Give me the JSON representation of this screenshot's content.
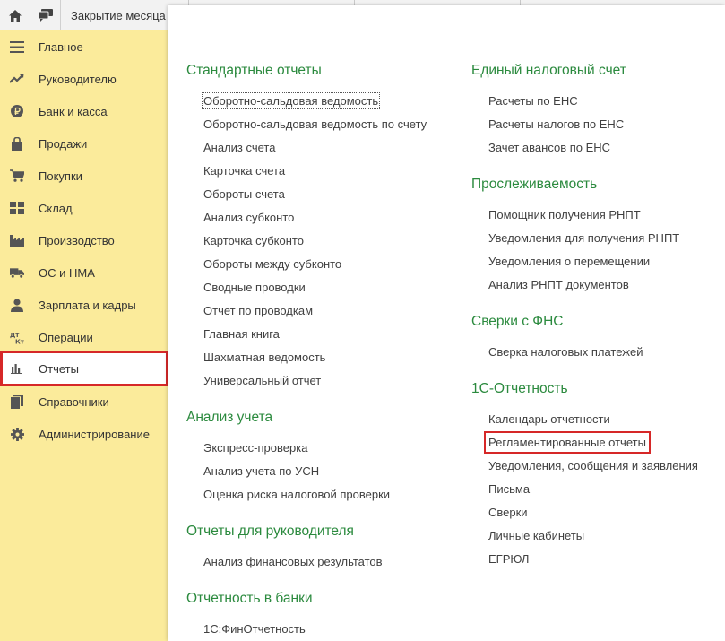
{
  "topbar": {
    "tab_title": "Закрытие месяца"
  },
  "sidebar": {
    "items": [
      {
        "label": "Главное",
        "icon": "menu-icon"
      },
      {
        "label": "Руководителю",
        "icon": "trend-icon"
      },
      {
        "label": "Банк и касса",
        "icon": "ruble-icon"
      },
      {
        "label": "Продажи",
        "icon": "shopping-bag-icon"
      },
      {
        "label": "Покупки",
        "icon": "cart-icon"
      },
      {
        "label": "Склад",
        "icon": "warehouse-icon"
      },
      {
        "label": "Производство",
        "icon": "factory-icon"
      },
      {
        "label": "ОС и НМА",
        "icon": "truck-icon"
      },
      {
        "label": "Зарплата и кадры",
        "icon": "person-icon"
      },
      {
        "label": "Операции",
        "icon": "dt-kt-icon",
        "glyph_dt": "Дт",
        "glyph_kt": "Кт"
      },
      {
        "label": "Отчеты",
        "icon": "bar-chart-icon"
      },
      {
        "label": "Справочники",
        "icon": "books-icon"
      },
      {
        "label": "Администрирование",
        "icon": "gear-icon"
      }
    ],
    "active": "Отчеты"
  },
  "colors": {
    "sidebar_bg": "#fbeb9b",
    "section_title": "#2b8a3e",
    "highlight": "#d62828"
  },
  "left_column": {
    "standard": {
      "title": "Стандартные отчеты",
      "links": [
        "Оборотно-сальдовая ведомость",
        "Оборотно-сальдовая ведомость по счету",
        "Анализ счета",
        "Карточка счета",
        "Обороты счета",
        "Анализ субконто",
        "Карточка субконто",
        "Обороты между субконто",
        "Сводные проводки",
        "Отчет по проводкам",
        "Главная книга",
        "Шахматная ведомость",
        "Универсальный отчет"
      ]
    },
    "analysis": {
      "title": "Анализ учета",
      "links": [
        "Экспресс-проверка",
        "Анализ учета по УСН",
        "Оценка риска налоговой проверки"
      ]
    },
    "manager": {
      "title": "Отчеты для руководителя",
      "links": [
        "Анализ финансовых результатов"
      ]
    },
    "bank": {
      "title": "Отчетность в банки",
      "links": [
        "1С:ФинОтчетность"
      ]
    }
  },
  "right_column": {
    "ens": {
      "title": "Единый налоговый счет",
      "links": [
        "Расчеты по ЕНС",
        "Расчеты налогов по ЕНС",
        "Зачет авансов по ЕНС"
      ]
    },
    "trace": {
      "title": "Прослеживаемость",
      "links": [
        "Помощник получения РНПТ",
        "Уведомления для получения РНПТ",
        "Уведомления о перемещении",
        "Анализ РНПТ документов"
      ]
    },
    "fns": {
      "title": "Сверки с ФНС",
      "links": [
        "Сверка налоговых платежей"
      ]
    },
    "reporting": {
      "title": "1С-Отчетность",
      "links": [
        "Календарь отчетности",
        "Регламентированные отчеты",
        "Уведомления, сообщения и заявления",
        "Письма",
        "Сверки",
        "Личные кабинеты",
        "ЕГРЮЛ"
      ]
    }
  }
}
